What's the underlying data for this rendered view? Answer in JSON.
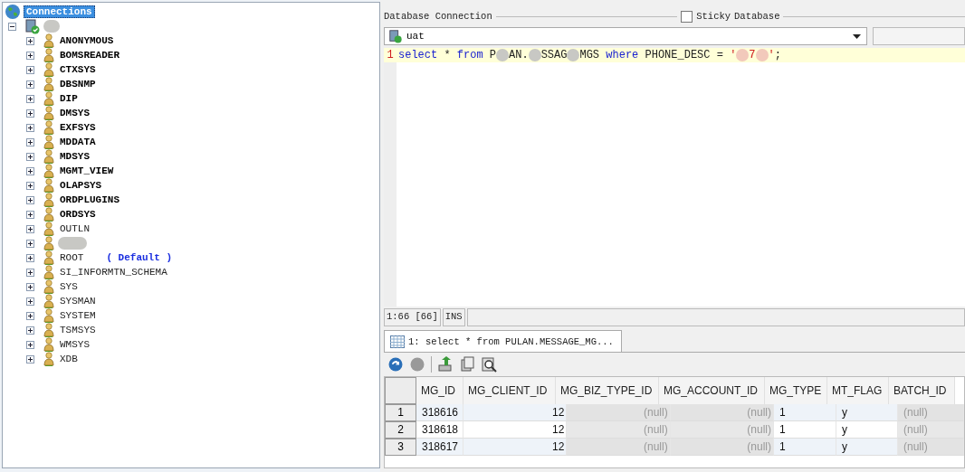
{
  "tree": {
    "root": {
      "label": "Connections",
      "selected": true,
      "children": [
        {
          "kind": "redacted",
          "expanded": true,
          "children": [
            {
              "label": "ANONYMOUS",
              "bold": true
            },
            {
              "label": "BOMSREADER",
              "bold": true
            },
            {
              "label": "CTXSYS",
              "bold": true
            },
            {
              "label": "DBSNMP",
              "bold": true
            },
            {
              "label": "DIP",
              "bold": true
            },
            {
              "label": "DMSYS",
              "bold": true
            },
            {
              "label": "EXFSYS",
              "bold": true
            },
            {
              "label": "MDDATA",
              "bold": true
            },
            {
              "label": "MDSYS",
              "bold": true
            },
            {
              "label": "MGMT_VIEW",
              "bold": true
            },
            {
              "label": "OLAPSYS",
              "bold": true
            },
            {
              "label": "ORDPLUGINS",
              "bold": true
            },
            {
              "label": "ORDSYS",
              "bold": true
            },
            {
              "label": "OUTLN",
              "bold": false
            },
            {
              "kind": "redacted"
            },
            {
              "label": "ROOT",
              "bold": false,
              "badge": "( Default )"
            },
            {
              "label": "SI_INFORMTN_SCHEMA",
              "bold": false
            },
            {
              "label": "SYS",
              "bold": false
            },
            {
              "label": "SYSMAN",
              "bold": false
            },
            {
              "label": "SYSTEM",
              "bold": false
            },
            {
              "label": "TSMSYS",
              "bold": false
            },
            {
              "label": "WMSYS",
              "bold": false
            },
            {
              "label": "XDB",
              "bold": false
            }
          ]
        }
      ]
    }
  },
  "connection": {
    "title": "Database Connection",
    "sticky": {
      "label": "Sticky",
      "checked": false
    },
    "database_label": "Database",
    "value": "uat"
  },
  "editor": {
    "line_number": "1",
    "tokens": [
      {
        "kind": "keyword",
        "text": "select"
      },
      {
        "kind": "plain",
        "text": " * "
      },
      {
        "kind": "keyword",
        "text": "from"
      },
      {
        "kind": "plain",
        "text": " P"
      },
      {
        "kind": "redacted"
      },
      {
        "kind": "plain",
        "text": "AN."
      },
      {
        "kind": "redacted"
      },
      {
        "kind": "plain",
        "text": "SSAG"
      },
      {
        "kind": "redacted"
      },
      {
        "kind": "plain",
        "text": "MGS "
      },
      {
        "kind": "keyword",
        "text": "where"
      },
      {
        "kind": "plain",
        "text": " PHONE_DESC = "
      },
      {
        "kind": "string",
        "text": "'"
      },
      {
        "kind": "redacted-warm"
      },
      {
        "kind": "string",
        "text": "7"
      },
      {
        "kind": "redacted-warm"
      },
      {
        "kind": "string",
        "text": "'"
      },
      {
        "kind": "plain",
        "text": ";"
      }
    ]
  },
  "status_bar": {
    "position": "1:66 [66]",
    "mode": "INS"
  },
  "result_tab": {
    "label": "1: select * from PULAN.MESSAGE_MG...",
    "selected": true
  },
  "grid": {
    "columns": [
      {
        "label": "MG_ID"
      },
      {
        "label": "MG_CLIENT_ID"
      },
      {
        "label": "MG_BIZ_TYPE_ID"
      },
      {
        "label": "MG_ACCOUNT_ID"
      },
      {
        "label": "MG_TYPE"
      },
      {
        "label": "MT_FLAG"
      },
      {
        "label": "BATCH_ID"
      }
    ],
    "rows": [
      {
        "number": "1",
        "cells": [
          {
            "text": "318616",
            "null": false
          },
          {
            "text": "12",
            "null": false
          },
          {
            "text": "(null)",
            "null": true
          },
          {
            "text": "(null)",
            "null": true
          },
          {
            "text": "1",
            "null": false
          },
          {
            "text": "y",
            "null": false
          },
          {
            "text": "(null)",
            "null": true
          }
        ]
      },
      {
        "number": "2",
        "cells": [
          {
            "text": "318618",
            "null": false
          },
          {
            "text": "12",
            "null": false
          },
          {
            "text": "(null)",
            "null": true
          },
          {
            "text": "(null)",
            "null": true
          },
          {
            "text": "1",
            "null": false
          },
          {
            "text": "y",
            "null": false
          },
          {
            "text": "(null)",
            "null": true
          }
        ]
      },
      {
        "number": "3",
        "cells": [
          {
            "text": "318617",
            "null": false
          },
          {
            "text": "12",
            "null": false
          },
          {
            "text": "(null)",
            "null": true
          },
          {
            "text": "(null)",
            "null": true
          },
          {
            "text": "1",
            "null": false
          },
          {
            "text": "y",
            "null": false
          },
          {
            "text": "(null)",
            "null": true
          }
        ]
      }
    ]
  }
}
